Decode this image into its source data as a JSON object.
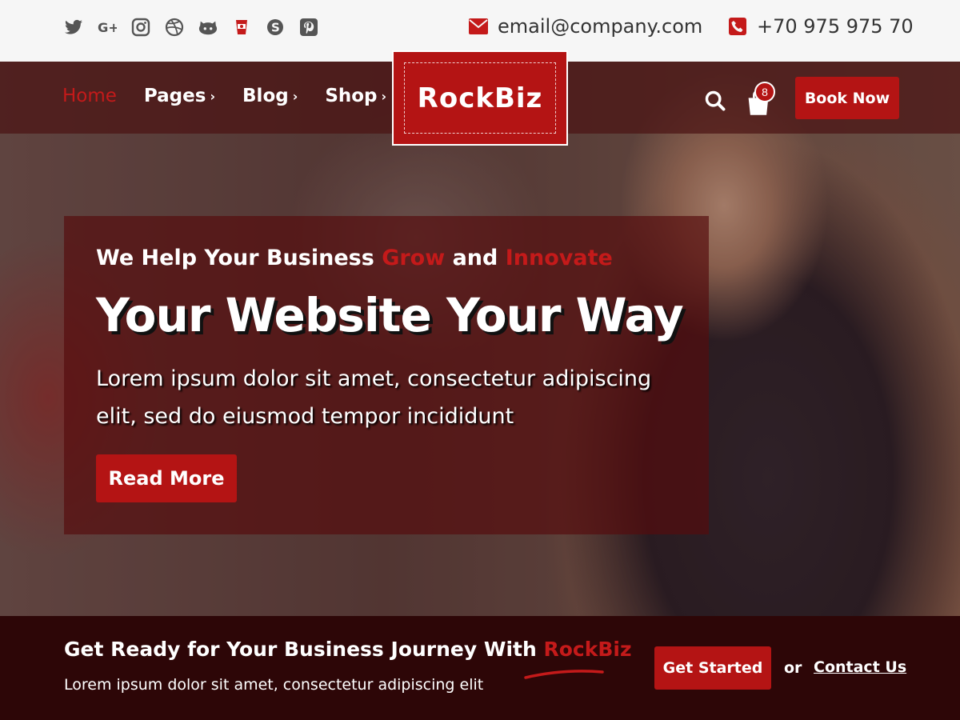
{
  "topbar": {
    "socials": [
      {
        "icon": "twitter-icon"
      },
      {
        "icon": "google-plus-icon"
      },
      {
        "icon": "instagram-icon"
      },
      {
        "icon": "dribbble-icon"
      },
      {
        "icon": "github-icon"
      },
      {
        "icon": "yelp-icon"
      },
      {
        "icon": "skype-icon"
      },
      {
        "icon": "pinterest-icon"
      }
    ],
    "email": "email@company.com",
    "phone": "+70 975 975 70"
  },
  "nav": {
    "items": [
      {
        "label": "Home",
        "active": true
      },
      {
        "label": "Pages",
        "chevron": "›"
      },
      {
        "label": "Blog",
        "chevron": "›"
      },
      {
        "label": "Shop",
        "chevron": "›"
      }
    ],
    "logo": "RockBiz",
    "cart_count": "8",
    "book_label": "Book Now"
  },
  "hero": {
    "tagline_a": "We Help Your Business ",
    "tagline_b": "Grow",
    "tagline_c": " and ",
    "tagline_d": "Innovate",
    "headline": "Your Website Your Way",
    "lead": "Lorem ipsum dolor sit amet, consectetur adipiscing elit, sed do eiusmod tempor incididunt",
    "button": "Read More"
  },
  "cta": {
    "title_a": "Get Ready for Your Business Journey With ",
    "title_b": "RockBiz",
    "subtitle": "Lorem ipsum dolor sit amet, consectetur adipiscing elit",
    "button": "Get Started",
    "or": "or",
    "contact": "Contact Us"
  },
  "colors": {
    "accent": "#b41414",
    "accent_text": "#c41a1a",
    "cta_bg": "#2d0607"
  }
}
